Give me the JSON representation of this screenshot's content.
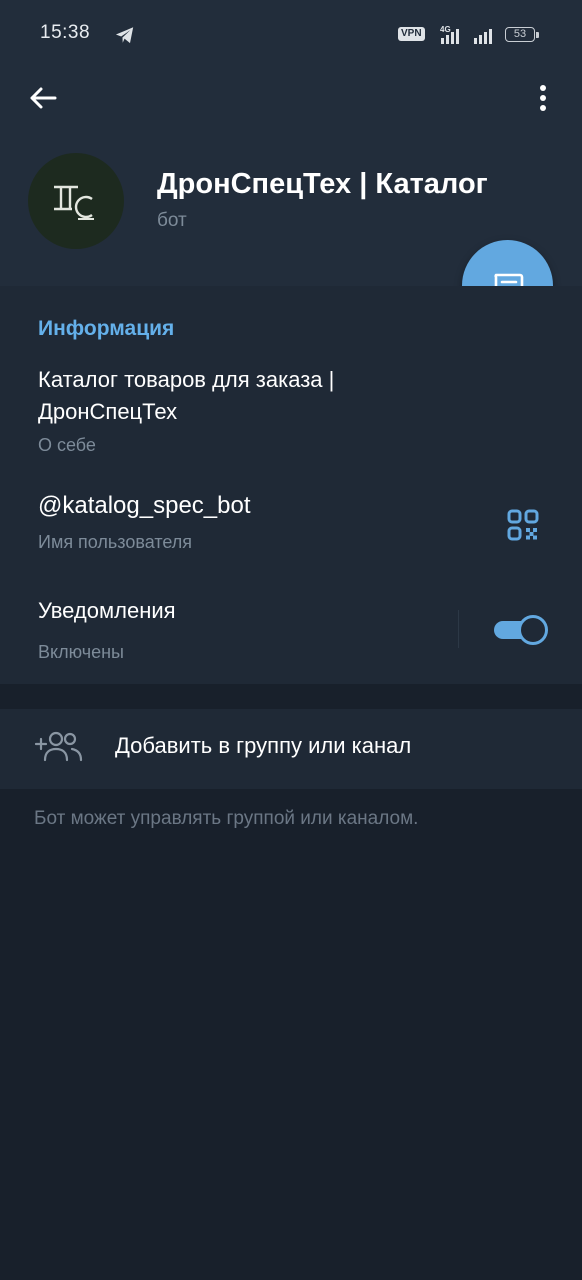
{
  "status_bar": {
    "time": "15:38",
    "vpn": "VPN",
    "network": "4G",
    "battery": "53"
  },
  "header": {
    "back_icon": "arrow-left-icon",
    "menu_icon": "more-vertical-icon"
  },
  "profile": {
    "name": "ДронСпецТех | Каталог",
    "status": "бот"
  },
  "fab_icon": "message-icon",
  "info": {
    "title": "Информация",
    "about": "Каталог товаров для заказа | ДронСпецТех",
    "about_caption": "О себе",
    "username": "@katalog_spec_bot",
    "username_caption": "Имя пользователя",
    "notifications": "Уведомления",
    "notifications_caption": "Включены",
    "notifications_on": true
  },
  "actions": {
    "add_to_group": "Добавить в группу или канал"
  },
  "footer_note": "Бот может управлять группой или каналом.",
  "colors": {
    "accent": "#62a8e0",
    "header_bg": "#222d3b",
    "section_bg": "#1f2936",
    "page_bg": "#18202b"
  }
}
